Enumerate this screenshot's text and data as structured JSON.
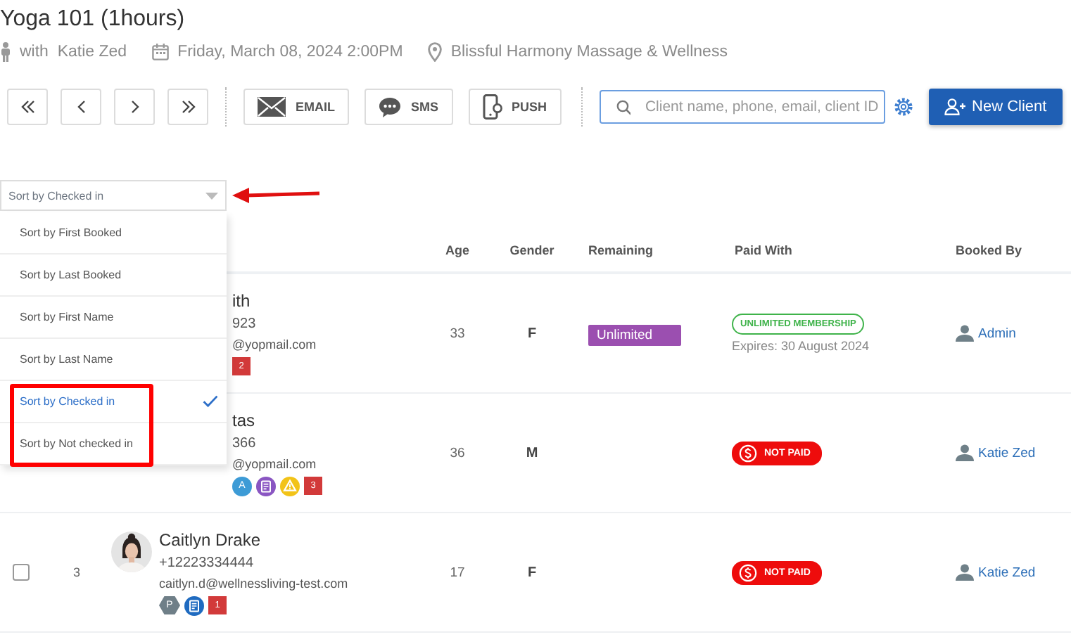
{
  "title": "Yoga 101 (1hours)",
  "meta": {
    "instructor": "with  Katie Zed",
    "datetime": "Friday, March 08, 2024 2:00PM",
    "location": "Blissful Harmony Massage & Wellness"
  },
  "toolbar": {
    "nav": [
      {
        "kind": "first"
      },
      {
        "kind": "prev"
      },
      {
        "kind": "next"
      },
      {
        "kind": "last"
      }
    ],
    "messages": [
      {
        "kind": "email",
        "label": "EMAIL"
      },
      {
        "kind": "sms",
        "label": "SMS"
      },
      {
        "kind": "push",
        "label": "PUSH"
      }
    ],
    "search": {
      "placeholder": "Client name, phone, email, client ID"
    },
    "new_client": "New Client"
  },
  "sort": {
    "value": "Sort by Checked in",
    "expanded": true,
    "options": [
      {
        "label": "Sort by First Booked",
        "selected": false
      },
      {
        "label": "Sort by Last Booked",
        "selected": false
      },
      {
        "label": "Sort by First Name",
        "selected": false
      },
      {
        "label": "Sort by Last Name",
        "selected": false
      },
      {
        "label": "Sort by Checked in",
        "selected": true
      },
      {
        "label": "Sort by Not checked in",
        "selected": false
      }
    ]
  },
  "table": {
    "columns": [
      "Age",
      "Gender",
      "Remaining",
      "Paid With",
      "Booked By"
    ],
    "rows": [
      {
        "covered": true,
        "name": "ith",
        "phone": "923",
        "email": "@yopmail.com",
        "badges": [
          {
            "kind": "count",
            "text": "2"
          }
        ],
        "age": "33",
        "gender": "F",
        "remaining": "Unlimited",
        "payment": {
          "kind": "membership",
          "label": "UNLIMITED MEMBERSHIP",
          "detail": "Expires: 30 August 2024"
        },
        "booked_by": "Admin"
      },
      {
        "covered": true,
        "name": "tas",
        "phone": "366",
        "email": "@yopmail.com",
        "badges": [
          {
            "kind": "letter",
            "text": "A",
            "color": "#3d9bd6"
          },
          {
            "kind": "doc",
            "color": "#8a56c2"
          },
          {
            "kind": "warning",
            "color": "#f2c318"
          },
          {
            "kind": "count",
            "text": "3"
          }
        ],
        "age": "36",
        "gender": "M",
        "payment": {
          "kind": "unpaid",
          "label": "NOT PAID"
        },
        "booked_by": "Katie Zed"
      },
      {
        "covered": false,
        "checked": false,
        "number": "3",
        "avatar": {
          "kind": "picture"
        },
        "name": "Caitlyn Drake",
        "phone": "+12223334444",
        "email": "caitlyn.d@wellnessliving-test.com",
        "badges": [
          {
            "kind": "hex",
            "text": "P",
            "color": "#6f7f88"
          },
          {
            "kind": "doc",
            "color": "#1f6bc0"
          },
          {
            "kind": "count",
            "text": "1"
          }
        ],
        "age": "17",
        "gender": "F",
        "payment": {
          "kind": "unpaid",
          "label": "NOT PAID"
        },
        "booked_by": "Katie Zed"
      }
    ]
  }
}
